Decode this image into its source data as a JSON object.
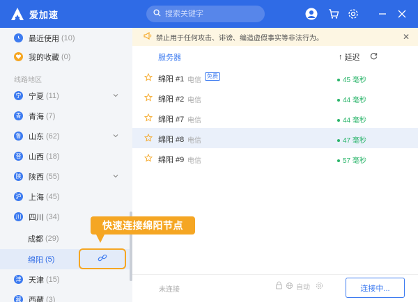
{
  "app": {
    "title": "爱加速"
  },
  "search": {
    "placeholder": "搜索关键字"
  },
  "sidebar": {
    "recent": {
      "label": "最近使用",
      "count": "(10)"
    },
    "favorites": {
      "label": "我的收藏",
      "count": "(0)"
    },
    "section_title": "线路地区",
    "regions": [
      {
        "badge": "宁",
        "label": "宁夏",
        "count": "(11)"
      },
      {
        "badge": "青",
        "label": "青海",
        "count": "(7)"
      },
      {
        "badge": "鲁",
        "label": "山东",
        "count": "(62)"
      },
      {
        "badge": "晋",
        "label": "山西",
        "count": "(18)"
      },
      {
        "badge": "陕",
        "label": "陕西",
        "count": "(55)"
      },
      {
        "badge": "沪",
        "label": "上海",
        "count": "(45)"
      },
      {
        "badge": "川",
        "label": "四川",
        "count": "(34)"
      },
      {
        "label": "成都",
        "count": "(29)"
      },
      {
        "label": "绵阳",
        "count": "(5)"
      },
      {
        "badge": "津",
        "label": "天津",
        "count": "(15)"
      },
      {
        "badge": "藏",
        "label": "西藏",
        "count": "(3)"
      }
    ]
  },
  "annotation": {
    "callout": "快速连接绵阳节点"
  },
  "notice": {
    "text": "禁止用于任何攻击、诽谤、编造虚假事实等非法行为。"
  },
  "table": {
    "col_server": "服务器",
    "col_latency": "延迟",
    "rows": [
      {
        "name": "绵阳 #1",
        "isp": "电信",
        "tag": "免费",
        "latency": "45 毫秒"
      },
      {
        "name": "绵阳 #2",
        "isp": "电信",
        "latency": "44 毫秒"
      },
      {
        "name": "绵阳 #7",
        "isp": "电信",
        "latency": "44 毫秒"
      },
      {
        "name": "绵阳 #8",
        "isp": "电信",
        "latency": "47 毫秒"
      },
      {
        "name": "绵阳 #9",
        "isp": "电信",
        "latency": "57 毫秒"
      }
    ]
  },
  "bottom": {
    "status": "未连接",
    "mode": "自动",
    "connect_label": "连接中..."
  },
  "colors": {
    "brand": "#2f6be6",
    "latency_good": "#2bb56b",
    "callout": "#f5a623"
  }
}
